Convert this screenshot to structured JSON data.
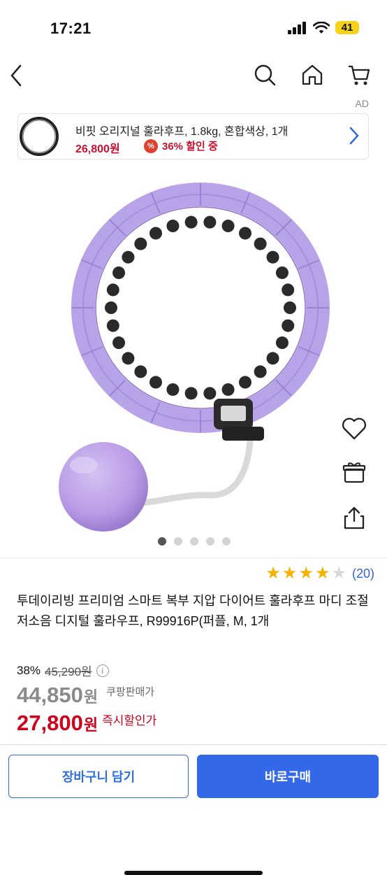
{
  "status_bar": {
    "time": "17:21",
    "battery": "41"
  },
  "ad": {
    "label": "AD",
    "title": "비핏 오리지널 훌라후프, 1.8kg, 혼합색상, 1개",
    "price": "26,800원",
    "badge": "%",
    "discount": "36% 할인 중"
  },
  "gallery": {
    "image_count": 5,
    "active_index": 0,
    "ring_color": "#b9a3e8",
    "ball_color": "#b89be6"
  },
  "product": {
    "rating": 4.0,
    "review_count": "(20)",
    "title": "투데이리빙 프리미엄 스마트 복부 지압 다이어트 훌라후프 마디 조절 저소음 디지털 훌라우프, R99916P(퍼플, M, 1개",
    "discount_rate": "38%",
    "original_price": "45,290원",
    "info_icon": "i",
    "coupang_price": "44,850",
    "coupang_won": "원",
    "coupang_label": "쿠팡판매가",
    "instant_price": "27,800",
    "instant_won": "원",
    "instant_label": "즉시할인가"
  },
  "actions": {
    "cart_label": "장바구니 담기",
    "buy_label": "바로구매"
  },
  "colors": {
    "accent": "#3369e8",
    "sale": "#d0021b",
    "star": "#f5b301"
  }
}
